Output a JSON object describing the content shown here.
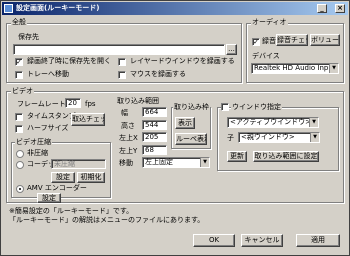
{
  "window": {
    "title": "設定画面(ルーキーモード)",
    "title_icon": "app-icon"
  },
  "title_buttons": {
    "minimize": "_",
    "maximize": "□",
    "close": "×"
  },
  "general": {
    "label": "全般",
    "save_folder_label": "保存先",
    "save_folder_value": "",
    "browse_label": "...",
    "open_folder_after_record": "録画終了時に保存先を開く",
    "tray_move": "トレーへ移動",
    "layered_window": "レイヤードウインドウを録画する",
    "record_mouse": "マウスを録画する"
  },
  "audio": {
    "label": "オーディオ",
    "record": "録音",
    "record_check_button": "録音チェック",
    "volume_button": "ボリューム",
    "device_label": "デバイス",
    "device_value": "Realtek HD Audio Input"
  },
  "video": {
    "label": "ビデオ",
    "framerate_label": "フレームレート",
    "framerate_value": "20",
    "fps_unit": "fps",
    "timestamp": "タイムスタンプ",
    "half_size": "ハーフサイズ",
    "capture_check_button": "取込チェック",
    "compression_label": "ビデオ圧縮",
    "uncompressed": "非圧縮",
    "codec": "コーデック",
    "codec_value": "未圧縮",
    "settings_button": "設定",
    "init_button": "初期化",
    "amv_encoder": "AMV エンコーダー",
    "amv_settings_button": "設定"
  },
  "capture_range": {
    "label": "取り込み範囲",
    "width_label": "幅",
    "width_value": "664",
    "height_label": "高さ",
    "height_value": "544",
    "left_label": "左上X",
    "left_value": "205",
    "top_label": "左上Y",
    "top_value": "68",
    "move_label": "移動",
    "move_value": "左上固定",
    "frame_label": "取り込み枠",
    "show_button": "表示",
    "loupe_button": "ルーペ表示"
  },
  "window_spec": {
    "label": "ウインドウ指定",
    "active_window": "<アクティブウインドウ>",
    "child_label": "子",
    "parent_window": "<親ウインドウ>",
    "refresh_button": "更新",
    "set_range_button": "取り込み範囲に設定"
  },
  "footer": {
    "note_line1": "※簡易設定の「ルーキーモード」です。",
    "note_line2": "「ルーキーモード」の解説はメニューのファイルにあります。",
    "ok": "OK",
    "cancel": "キャンセル",
    "apply": "適用"
  }
}
